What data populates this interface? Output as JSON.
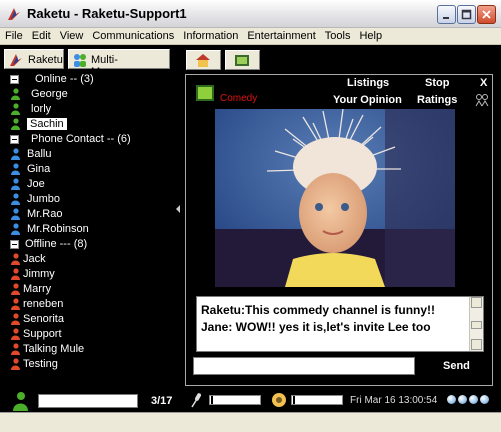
{
  "window": {
    "title": "Raketu - Raketu-Support1",
    "controls": [
      "minimize-icon",
      "maximize-icon",
      "close-icon"
    ]
  },
  "menu": [
    "File",
    "Edit",
    "View",
    "Communications",
    "Information",
    "Entertainment",
    "Tools",
    "Help"
  ],
  "left_toolbar": {
    "raketu_label": "Raketu",
    "messenger_label": "Multi-Messenger"
  },
  "contacts": {
    "groups": [
      {
        "label": "Online -- (3)",
        "members": [
          "George",
          "lorly",
          "Sachin"
        ],
        "selected": "Sachin"
      },
      {
        "label": "Phone Contact -- (6)",
        "members": [
          "Ballu",
          "Gina",
          "Joe",
          "Jumbo",
          "Mr.Rao",
          "Mr.Robinson"
        ]
      },
      {
        "label": "Offline --- (8)",
        "members": [
          "Jack",
          "Jimmy",
          "Marry",
          "reneben",
          "Senorita",
          "Support",
          "Talking Mule",
          "Testing"
        ]
      }
    ],
    "status_colors": {
      "online": "#4caf2a",
      "phone": "#3c8ee0",
      "offline": "#e04a2a"
    }
  },
  "list_footer": {
    "count": "3/17"
  },
  "channel": {
    "category": "Comedy",
    "links": {
      "listings": "Listings",
      "stop": "Stop",
      "close": "X",
      "opinion": "Your Opinion",
      "ratings": "Ratings"
    }
  },
  "chat": {
    "lines": [
      "Raketu:This commedy channel is funny!!",
      "Jane: WOW!! yes it is,let's invite Lee too"
    ],
    "send_label": "Send",
    "input_value": ""
  },
  "statusbar": {
    "datetime": "Fri Mar 16 13:00:54"
  }
}
